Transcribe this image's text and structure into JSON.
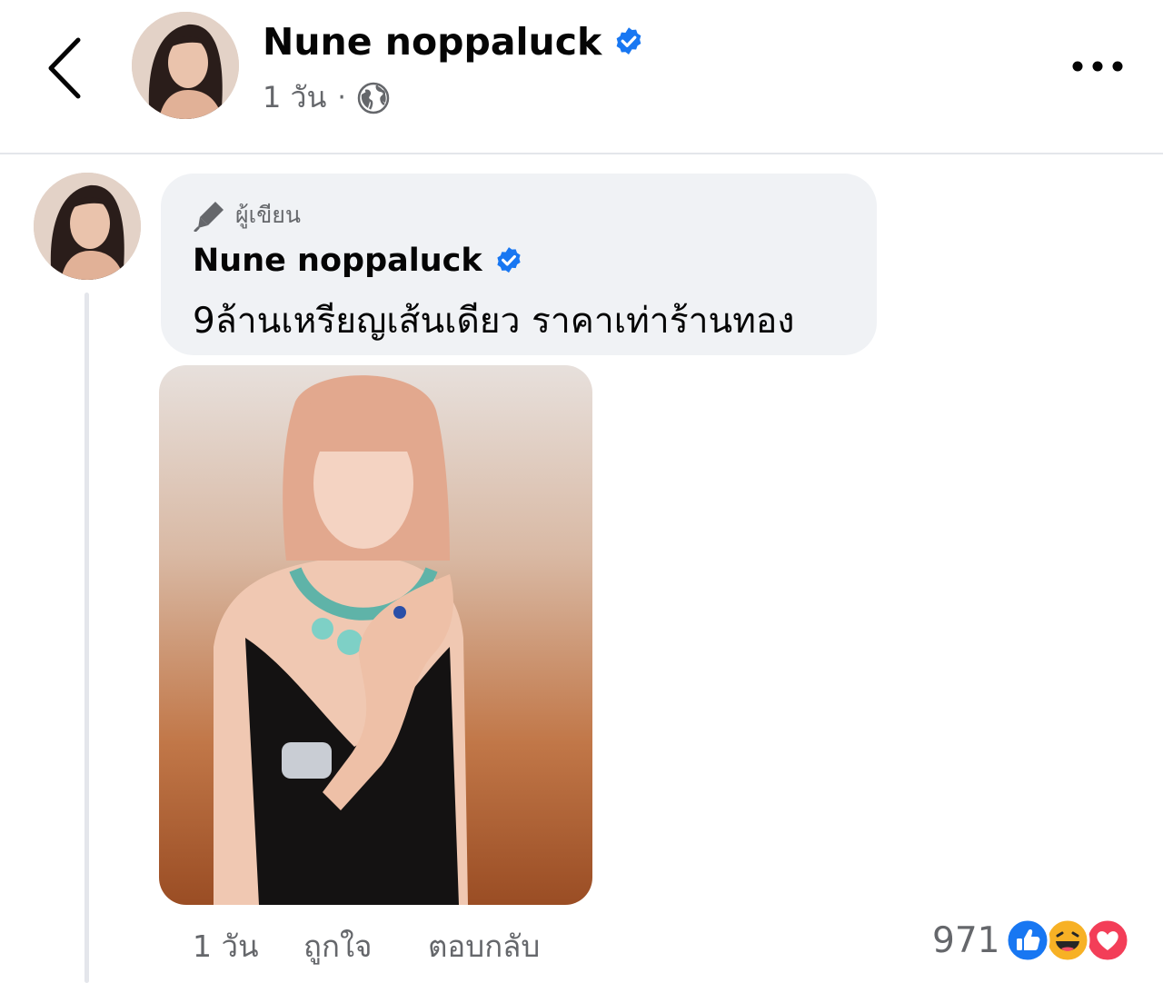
{
  "post": {
    "author": "Nune noppaluck",
    "time": "1 วัน",
    "separator": "·"
  },
  "comment": {
    "badge": "ผู้เขียน",
    "author": "Nune noppaluck",
    "text": "9ล้านเหรียญเส้นเดียว ราคาเท่าร้านทอง",
    "time": "1 วัน",
    "like_label": "ถูกใจ",
    "reply_label": "ตอบกลับ",
    "reaction_count": "971",
    "reaction_types": [
      "like",
      "haha",
      "love"
    ]
  },
  "colors": {
    "verified": "#1877f2",
    "like": "#1877f2",
    "love": "#f33e58",
    "haha": "#f7b125",
    "bubble": "#f0f2f5",
    "meta_text": "#65676b"
  },
  "icons": {
    "back": "chevron-left-icon",
    "more": "more-horizontal-icon",
    "audience": "globe-icon",
    "badge": "pen-icon",
    "verified": "verified-badge-icon"
  }
}
